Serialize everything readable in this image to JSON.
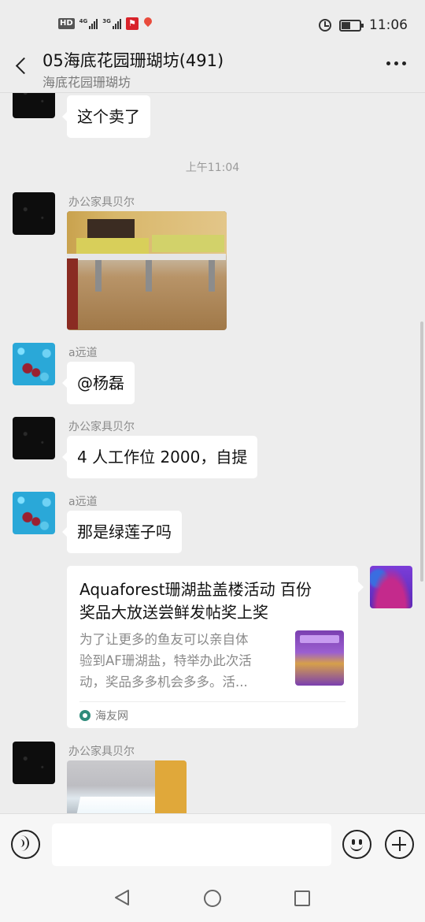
{
  "status_bar": {
    "hd": "HD",
    "sim1": "4G",
    "sim2": "3G",
    "time": "11:06"
  },
  "header": {
    "title": "05海底花园珊瑚坊(491)",
    "subtitle": "海底花园珊瑚坊"
  },
  "messages": [
    {
      "type": "text",
      "sender": "",
      "text": "这个卖了",
      "avatar": "dark-sky"
    },
    {
      "type": "time",
      "text": "上午11:04"
    },
    {
      "type": "image",
      "sender": "办公家具贝尔",
      "avatar": "dark-sky",
      "image": "office-desks-photo"
    },
    {
      "type": "text",
      "sender": "a远道",
      "text": "@杨磊",
      "avatar": "blue-beads"
    },
    {
      "type": "text",
      "sender": "办公家具贝尔",
      "text": "4 人工作位 2000，自提",
      "avatar": "dark-sky"
    },
    {
      "type": "text",
      "sender": "a远道",
      "text": "那是绿莲子吗",
      "avatar": "blue-beads"
    },
    {
      "type": "link",
      "title": "Aquaforest珊湖盐盖楼活动 百份\n奖品大放送尝鲜发帖奖上奖",
      "description": "为了让更多的鱼友可以亲自体\n验到AF珊湖盐，特举办此次活\n动，奖品多多机会多多。活...",
      "source": "海友网",
      "avatar": "coral",
      "outgoing": true
    },
    {
      "type": "image",
      "sender": "办公家具贝尔",
      "avatar": "dark-sky",
      "image": "light-table-photo"
    }
  ],
  "input_bar": {
    "voice_icon": "voice-icon",
    "emoji_icon": "emoji-icon",
    "plus_icon": "plus-icon"
  },
  "colors": {
    "background": "#ededed",
    "bubble": "#ffffff",
    "meta_text": "#8a8a8a"
  }
}
